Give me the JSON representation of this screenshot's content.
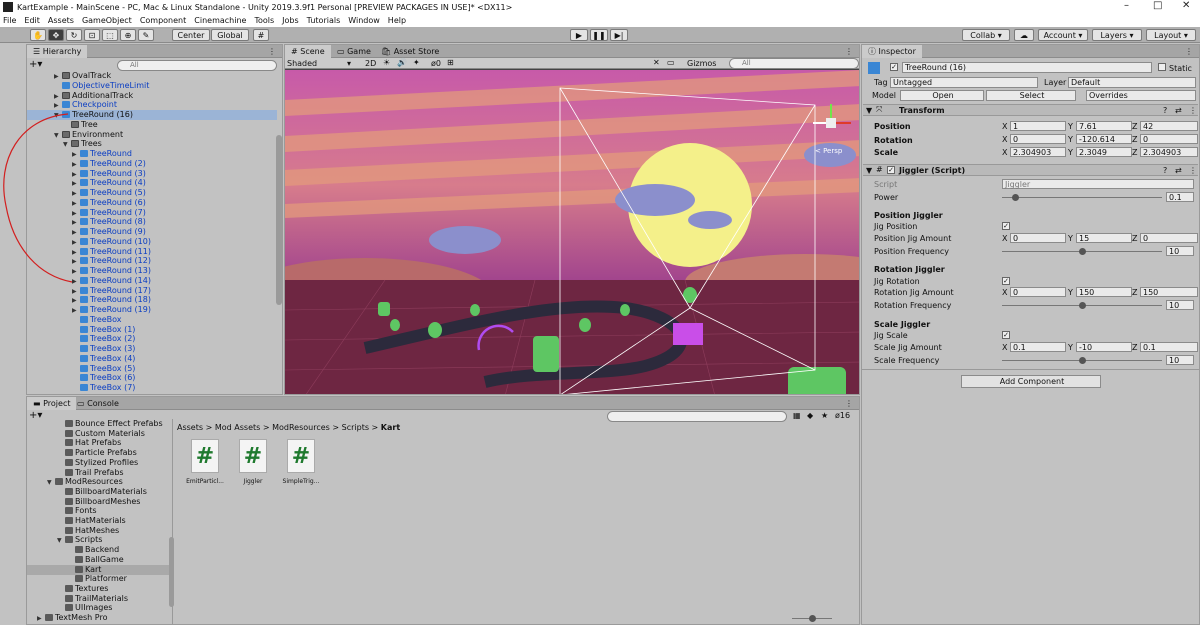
{
  "window": {
    "title": "KartExample - MainScene - PC, Mac & Linux Standalone - Unity 2019.3.9f1 Personal [PREVIEW PACKAGES IN USE]* <DX11>",
    "minimize": "–",
    "maximize": "□",
    "close": "✕"
  },
  "menu": [
    "File",
    "Edit",
    "Assets",
    "GameObject",
    "Component",
    "Cinemachine",
    "Tools",
    "Jobs",
    "Tutorials",
    "Window",
    "Help"
  ],
  "toolbar": {
    "center_label": "Center",
    "global_label": "Global",
    "collab_label": "Collab ▾",
    "account_label": "Account",
    "layers_label": "Layers",
    "layout_label": "Layout"
  },
  "hierarchy": {
    "tab_label": "Hierarchy",
    "search_placeholder": "All",
    "rows": [
      {
        "label": "OvalTrack",
        "indent": 1,
        "icon": "cubeg",
        "blue": false,
        "arrow": "▶"
      },
      {
        "label": "ObjectiveTimeLimit",
        "indent": 1,
        "icon": "cube",
        "blue": true,
        "arrow": ""
      },
      {
        "label": "AdditionalTrack",
        "indent": 1,
        "icon": "cubeg",
        "blue": false,
        "arrow": "▶"
      },
      {
        "label": "Checkpoint",
        "indent": 1,
        "icon": "cube",
        "blue": true,
        "arrow": "▶"
      },
      {
        "label": "TreeRound (16)",
        "indent": 1,
        "icon": "cube",
        "blue": false,
        "arrow": "▼",
        "selected": true
      },
      {
        "label": "Tree",
        "indent": 2,
        "icon": "cubeg",
        "blue": false,
        "arrow": ""
      },
      {
        "label": "Environment",
        "indent": 1,
        "icon": "cubeg",
        "blue": false,
        "arrow": "▼"
      },
      {
        "label": "Trees",
        "indent": 2,
        "icon": "cubeg",
        "blue": false,
        "arrow": "▼"
      },
      {
        "label": "TreeRound",
        "indent": 3,
        "icon": "cube",
        "blue": true,
        "arrow": "▶"
      },
      {
        "label": "TreeRound (2)",
        "indent": 3,
        "icon": "cube",
        "blue": true,
        "arrow": "▶"
      },
      {
        "label": "TreeRound (3)",
        "indent": 3,
        "icon": "cube",
        "blue": true,
        "arrow": "▶"
      },
      {
        "label": "TreeRound (4)",
        "indent": 3,
        "icon": "cube",
        "blue": true,
        "arrow": "▶"
      },
      {
        "label": "TreeRound (5)",
        "indent": 3,
        "icon": "cube",
        "blue": true,
        "arrow": "▶"
      },
      {
        "label": "TreeRound (6)",
        "indent": 3,
        "icon": "cube",
        "blue": true,
        "arrow": "▶"
      },
      {
        "label": "TreeRound (7)",
        "indent": 3,
        "icon": "cube",
        "blue": true,
        "arrow": "▶"
      },
      {
        "label": "TreeRound (8)",
        "indent": 3,
        "icon": "cube",
        "blue": true,
        "arrow": "▶"
      },
      {
        "label": "TreeRound (9)",
        "indent": 3,
        "icon": "cube",
        "blue": true,
        "arrow": "▶"
      },
      {
        "label": "TreeRound (10)",
        "indent": 3,
        "icon": "cube",
        "blue": true,
        "arrow": "▶"
      },
      {
        "label": "TreeRound (11)",
        "indent": 3,
        "icon": "cube",
        "blue": true,
        "arrow": "▶"
      },
      {
        "label": "TreeRound (12)",
        "indent": 3,
        "icon": "cube",
        "blue": true,
        "arrow": "▶"
      },
      {
        "label": "TreeRound (13)",
        "indent": 3,
        "icon": "cube",
        "blue": true,
        "arrow": "▶"
      },
      {
        "label": "TreeRound (14)",
        "indent": 3,
        "icon": "cube",
        "blue": true,
        "arrow": "▶"
      },
      {
        "label": "TreeRound (17)",
        "indent": 3,
        "icon": "cube",
        "blue": true,
        "arrow": "▶"
      },
      {
        "label": "TreeRound (18)",
        "indent": 3,
        "icon": "cube",
        "blue": true,
        "arrow": "▶"
      },
      {
        "label": "TreeRound (19)",
        "indent": 3,
        "icon": "cube",
        "blue": true,
        "arrow": "▶"
      },
      {
        "label": "TreeBox",
        "indent": 3,
        "icon": "cube",
        "blue": true,
        "arrow": ""
      },
      {
        "label": "TreeBox (1)",
        "indent": 3,
        "icon": "cube",
        "blue": true,
        "arrow": ""
      },
      {
        "label": "TreeBox (2)",
        "indent": 3,
        "icon": "cube",
        "blue": true,
        "arrow": ""
      },
      {
        "label": "TreeBox (3)",
        "indent": 3,
        "icon": "cube",
        "blue": true,
        "arrow": ""
      },
      {
        "label": "TreeBox (4)",
        "indent": 3,
        "icon": "cube",
        "blue": true,
        "arrow": ""
      },
      {
        "label": "TreeBox (5)",
        "indent": 3,
        "icon": "cube",
        "blue": true,
        "arrow": ""
      },
      {
        "label": "TreeBox (6)",
        "indent": 3,
        "icon": "cube",
        "blue": true,
        "arrow": ""
      },
      {
        "label": "TreeBox (7)",
        "indent": 3,
        "icon": "cube",
        "blue": true,
        "arrow": ""
      }
    ]
  },
  "scene": {
    "tabs": [
      "Scene",
      "Game",
      "Asset Store"
    ],
    "shaded_label": "Shaded",
    "mode_2d": "2D",
    "fx_count": "0",
    "gizmos_label": "Gizmos",
    "search_placeholder": "All",
    "persp_label": "< Persp"
  },
  "project": {
    "tabs": [
      "Project",
      "Console"
    ],
    "hidden_count": "16",
    "breadcrumb": [
      "Assets",
      "Mod Assets",
      "ModResources",
      "Scripts",
      "Kart"
    ],
    "tree": [
      {
        "label": "Bounce Effect Prefabs",
        "indent": 3
      },
      {
        "label": "Custom Materials",
        "indent": 3
      },
      {
        "label": "Hat Prefabs",
        "indent": 3
      },
      {
        "label": "Particle Prefabs",
        "indent": 3
      },
      {
        "label": "Stylized Profiles",
        "indent": 3
      },
      {
        "label": "Trail Prefabs",
        "indent": 3
      },
      {
        "label": "ModResources",
        "indent": 2,
        "arrow": "▼"
      },
      {
        "label": "BillboardMaterials",
        "indent": 3
      },
      {
        "label": "BillboardMeshes",
        "indent": 3
      },
      {
        "label": "Fonts",
        "indent": 3
      },
      {
        "label": "HatMaterials",
        "indent": 3
      },
      {
        "label": "HatMeshes",
        "indent": 3
      },
      {
        "label": "Scripts",
        "indent": 3,
        "arrow": "▼"
      },
      {
        "label": "Backend",
        "indent": 4
      },
      {
        "label": "BallGame",
        "indent": 4
      },
      {
        "label": "Kart",
        "indent": 4,
        "selected": true
      },
      {
        "label": "Platformer",
        "indent": 4
      },
      {
        "label": "Textures",
        "indent": 3
      },
      {
        "label": "TrailMaterials",
        "indent": 3
      },
      {
        "label": "UIImages",
        "indent": 3
      },
      {
        "label": "TextMesh Pro",
        "indent": 1,
        "arrow": "▶"
      }
    ],
    "assets": [
      {
        "name": "EmitParticl...",
        "glyph": "#"
      },
      {
        "name": "Jiggler",
        "glyph": "#"
      },
      {
        "name": "SimpleTrig...",
        "glyph": "#"
      }
    ]
  },
  "inspector": {
    "tab_label": "Inspector",
    "object_name": "TreeRound (16)",
    "static_label": "Static",
    "tag_label": "Tag",
    "tag_value": "Untagged",
    "layer_label": "Layer",
    "layer_value": "Default",
    "model_label": "Model",
    "open_label": "Open",
    "select_label": "Select",
    "overrides_label": "Overrides",
    "transform": {
      "title": "Transform",
      "position_label": "Position",
      "rotation_label": "Rotation",
      "scale_label": "Scale",
      "position": [
        "1",
        "7.61",
        "42"
      ],
      "rotation": [
        "0",
        "-120.614",
        "0"
      ],
      "scale": [
        "2.304903",
        "2.3049",
        "2.304903"
      ]
    },
    "jiggler": {
      "title": "Jiggler (Script)",
      "script_label": "Script",
      "script_value": "Jiggler",
      "power_label": "Power",
      "power_value": "0.1",
      "power_fraction": 0.08,
      "pos_header": "Position Jiggler",
      "jig_position_label": "Jig Position",
      "pos_amount_label": "Position Jig Amount",
      "pos_amount": [
        "0",
        "15",
        "0"
      ],
      "pos_freq_label": "Position Frequency",
      "pos_freq": "10",
      "pos_freq_fraction": 0.5,
      "rot_header": "Rotation Jiggler",
      "jig_rotation_label": "Jig Rotation",
      "rot_amount_label": "Rotation Jig Amount",
      "rot_amount": [
        "0",
        "150",
        "150"
      ],
      "rot_freq_label": "Rotation Frequency",
      "rot_freq": "10",
      "rot_freq_fraction": 0.5,
      "scale_header": "Scale Jiggler",
      "jig_scale_label": "Jig Scale",
      "scale_amount_label": "Scale Jig Amount",
      "scale_amount": [
        "0.1",
        "-10",
        "0.1"
      ],
      "scale_freq_label": "Scale Frequency",
      "scale_freq": "10",
      "scale_freq_fraction": 0.5,
      "check": "✓"
    },
    "add_component_label": "Add Component",
    "axis": [
      "X",
      "Y",
      "Z"
    ]
  }
}
